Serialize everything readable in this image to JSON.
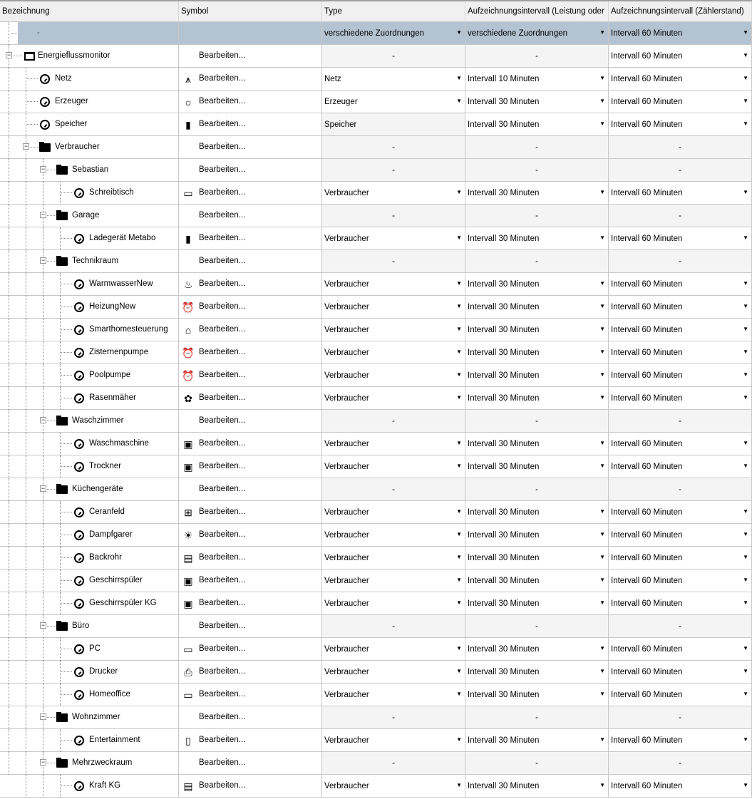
{
  "headers": [
    "Bezeichnung",
    "Symbol",
    "Type",
    "Aufzeichnungsintervall (Leistung oder",
    "Aufzeichnungsintervall (Zählerstand)"
  ],
  "edit_label": "Bearbeiten...",
  "selected_row": {
    "name": "-",
    "type": "verschiedene Zuordnungen",
    "int1": "verschiedene Zuordnungen",
    "int2": "Intervall 60 Minuten"
  },
  "rows": [
    {
      "name": "Energieflussmonitor",
      "level": 0,
      "kind": "root",
      "symbol": "",
      "type": "-",
      "int1": "-",
      "int2": "Intervall 60 Minuten"
    },
    {
      "name": "Netz",
      "level": 1,
      "kind": "meter",
      "symbol": "power-tower",
      "type": "Netz",
      "int1": "Intervall 10 Minuten",
      "int2": "Intervall 60 Minuten"
    },
    {
      "name": "Erzeuger",
      "level": 1,
      "kind": "meter",
      "symbol": "solar-panel",
      "type": "Erzeuger",
      "int1": "Intervall 30 Minuten",
      "int2": "Intervall 60 Minuten"
    },
    {
      "name": "Speicher",
      "level": 1,
      "kind": "meter",
      "symbol": "battery",
      "type": "Speicher",
      "int1": "Intervall 30 Minuten",
      "int2": "Intervall 60 Minuten",
      "type_fixed": true
    },
    {
      "name": "Verbraucher",
      "level": 1,
      "kind": "folder",
      "symbol": "",
      "type": "-",
      "int1": "-",
      "int2": "-"
    },
    {
      "name": "Sebastian",
      "level": 2,
      "kind": "folder",
      "symbol": "",
      "type": "-",
      "int1": "-",
      "int2": "-"
    },
    {
      "name": "Schreibtisch",
      "level": 3,
      "kind": "meter",
      "symbol": "computer",
      "type": "Verbraucher",
      "int1": "Intervall 30 Minuten",
      "int2": "Intervall 60 Minuten"
    },
    {
      "name": "Garage",
      "level": 2,
      "kind": "folder",
      "symbol": "",
      "type": "-",
      "int1": "-",
      "int2": "-"
    },
    {
      "name": "Ladegerät Metabo",
      "level": 3,
      "kind": "meter",
      "symbol": "battery",
      "type": "Verbraucher",
      "int1": "Intervall 30 Minuten",
      "int2": "Intervall 60 Minuten"
    },
    {
      "name": "Technikraum",
      "level": 2,
      "kind": "folder",
      "symbol": "",
      "type": "-",
      "int1": "-",
      "int2": "-"
    },
    {
      "name": "WarmwasserNew",
      "level": 3,
      "kind": "meter",
      "symbol": "water-heater",
      "type": "Verbraucher",
      "int1": "Intervall 30 Minuten",
      "int2": "Intervall 60 Minuten"
    },
    {
      "name": "HeizungNew",
      "level": 3,
      "kind": "meter",
      "symbol": "pump",
      "type": "Verbraucher",
      "int1": "Intervall 30 Minuten",
      "int2": "Intervall 60 Minuten"
    },
    {
      "name": "Smarthomesteuerung",
      "level": 3,
      "kind": "meter",
      "symbol": "house",
      "type": "Verbraucher",
      "int1": "Intervall 30 Minuten",
      "int2": "Intervall 60 Minuten"
    },
    {
      "name": "Zisternenpumpe",
      "level": 3,
      "kind": "meter",
      "symbol": "pump",
      "type": "Verbraucher",
      "int1": "Intervall 30 Minuten",
      "int2": "Intervall 60 Minuten"
    },
    {
      "name": "Poolpumpe",
      "level": 3,
      "kind": "meter",
      "symbol": "pump",
      "type": "Verbraucher",
      "int1": "Intervall 30 Minuten",
      "int2": "Intervall 60 Minuten"
    },
    {
      "name": "Rasenmäher",
      "level": 3,
      "kind": "meter",
      "symbol": "flower",
      "type": "Verbraucher",
      "int1": "Intervall 30 Minuten",
      "int2": "Intervall 60 Minuten"
    },
    {
      "name": "Waschzimmer",
      "level": 2,
      "kind": "folder",
      "symbol": "",
      "type": "-",
      "int1": "-",
      "int2": "-"
    },
    {
      "name": "Waschmaschine",
      "level": 3,
      "kind": "meter",
      "symbol": "appliance",
      "type": "Verbraucher",
      "int1": "Intervall 30 Minuten",
      "int2": "Intervall 60 Minuten"
    },
    {
      "name": "Trockner",
      "level": 3,
      "kind": "meter",
      "symbol": "appliance",
      "type": "Verbraucher",
      "int1": "Intervall 30 Minuten",
      "int2": "Intervall 60 Minuten"
    },
    {
      "name": "Küchengeräte",
      "level": 2,
      "kind": "folder",
      "symbol": "",
      "type": "-",
      "int1": "-",
      "int2": "-"
    },
    {
      "name": "Ceranfeld",
      "level": 3,
      "kind": "meter",
      "symbol": "cooktop",
      "type": "Verbraucher",
      "int1": "Intervall 30 Minuten",
      "int2": "Intervall 60 Minuten"
    },
    {
      "name": "Dampfgarer",
      "level": 3,
      "kind": "meter",
      "symbol": "lamp",
      "type": "Verbraucher",
      "int1": "Intervall 30 Minuten",
      "int2": "Intervall 60 Minuten"
    },
    {
      "name": "Backrohr",
      "level": 3,
      "kind": "meter",
      "symbol": "oven",
      "type": "Verbraucher",
      "int1": "Intervall 30 Minuten",
      "int2": "Intervall 60 Minuten"
    },
    {
      "name": "Geschirrspüler",
      "level": 3,
      "kind": "meter",
      "symbol": "appliance",
      "type": "Verbraucher",
      "int1": "Intervall 30 Minuten",
      "int2": "Intervall 60 Minuten"
    },
    {
      "name": "Geschirrspüler KG",
      "level": 3,
      "kind": "meter",
      "symbol": "appliance",
      "type": "Verbraucher",
      "int1": "Intervall 30 Minuten",
      "int2": "Intervall 60 Minuten"
    },
    {
      "name": "Büro",
      "level": 2,
      "kind": "folder",
      "symbol": "",
      "type": "-",
      "int1": "-",
      "int2": "-"
    },
    {
      "name": "PC",
      "level": 3,
      "kind": "meter",
      "symbol": "computer",
      "type": "Verbraucher",
      "int1": "Intervall 30 Minuten",
      "int2": "Intervall 60 Minuten"
    },
    {
      "name": "Drucker",
      "level": 3,
      "kind": "meter",
      "symbol": "printer",
      "type": "Verbraucher",
      "int1": "Intervall 30 Minuten",
      "int2": "Intervall 60 Minuten"
    },
    {
      "name": "Homeoffice",
      "level": 3,
      "kind": "meter",
      "symbol": "computer",
      "type": "Verbraucher",
      "int1": "Intervall 30 Minuten",
      "int2": "Intervall 60 Minuten"
    },
    {
      "name": "Wohnzimmer",
      "level": 2,
      "kind": "folder",
      "symbol": "",
      "type": "-",
      "int1": "-",
      "int2": "-"
    },
    {
      "name": "Entertainment",
      "level": 3,
      "kind": "meter",
      "symbol": "tv",
      "type": "Verbraucher",
      "int1": "Intervall 30 Minuten",
      "int2": "Intervall 60 Minuten"
    },
    {
      "name": "Mehrzweckraum",
      "level": 2,
      "kind": "folder",
      "symbol": "",
      "type": "-",
      "int1": "-",
      "int2": "-"
    },
    {
      "name": "Kraft KG",
      "level": 3,
      "kind": "meter",
      "symbol": "oven",
      "type": "Verbraucher",
      "int1": "Intervall 30 Minuten",
      "int2": "Intervall 60 Minuten"
    }
  ]
}
